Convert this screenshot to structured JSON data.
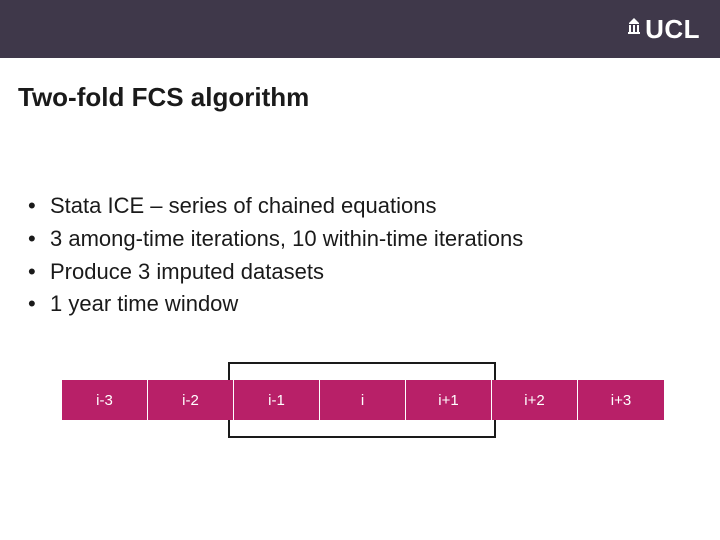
{
  "header": {
    "logo_text": "UCL"
  },
  "title": "Two-fold FCS algorithm",
  "bullets": [
    "Stata ICE – series of chained equations",
    "3 among-time iterations, 10 within-time iterations",
    "Produce 3 imputed datasets",
    "1 year time window"
  ],
  "timeline": {
    "cells": [
      "i-3",
      "i-2",
      "i-1",
      "i",
      "i+1",
      "i+2",
      "i+3"
    ]
  }
}
